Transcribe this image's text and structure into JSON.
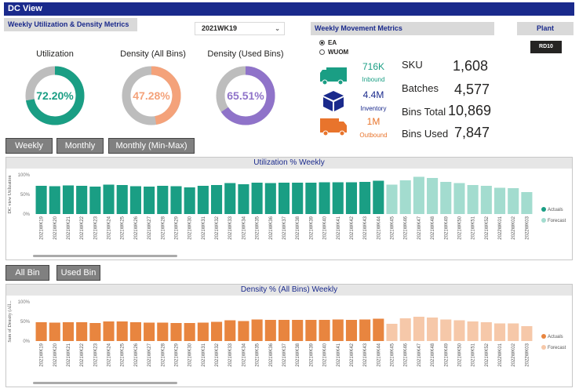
{
  "title": "DC View",
  "weekly_header": "Weekly Utilization & Density Metrics",
  "week_select": "2021WK19",
  "movement_header": "Weekly Movement Metrics",
  "plant": {
    "label": "Plant",
    "value": "RD10"
  },
  "uom": {
    "options": [
      "EA",
      "WUOM"
    ],
    "selected": "EA"
  },
  "gauges": [
    {
      "title": "Utilization",
      "value": "72.20%",
      "pct": 72.2,
      "color": "#1a9e84"
    },
    {
      "title": "Density (All Bins)",
      "value": "47.28%",
      "pct": 47.28,
      "color": "#f4a27a"
    },
    {
      "title": "Density (Used Bins)",
      "value": "65.51%",
      "pct": 65.51,
      "color": "#8f73c9"
    }
  ],
  "movement": {
    "inbound": {
      "value": "716K",
      "label": "Inbound",
      "color": "#1a9e84"
    },
    "inventory": {
      "value": "4.4M",
      "label": "Inventory",
      "color": "#1a2a8c"
    },
    "outbound": {
      "value": "1M",
      "label": "Outbound",
      "color": "#e8742c"
    }
  },
  "kpis": [
    {
      "label": "SKU",
      "value": "1,608"
    },
    {
      "label": "Batches",
      "value": "4,577"
    },
    {
      "label": "Bins Total",
      "value": "10,869"
    },
    {
      "label": "Bins Used",
      "value": "7,847"
    }
  ],
  "period_buttons": [
    "Weekly",
    "Monthly",
    "Monthly (Min-Max)"
  ],
  "bin_buttons": [
    "All Bin",
    "Used Bin"
  ],
  "colors": {
    "teal": "#1a9e84",
    "teal_light": "#a3dccf",
    "orange": "#e8853f",
    "orange_light": "#f6c8a9",
    "navy": "#1a2a8c"
  },
  "chart_data": [
    {
      "type": "bar",
      "title": "Utilization % Weekly",
      "ylabel": "DC view Utilization",
      "ylim": [
        0,
        100
      ],
      "yticks": [
        "100%",
        "50%",
        "0%"
      ],
      "categories": [
        "2021WK19",
        "2021WK20",
        "2021WK21",
        "2021WK22",
        "2021WK23",
        "2021WK24",
        "2021WK25",
        "2021WK26",
        "2021WK27",
        "2021WK28",
        "2021WK29",
        "2021WK30",
        "2021WK31",
        "2021WK32",
        "2021WK33",
        "2021WK34",
        "2021WK35",
        "2021WK36",
        "2021WK37",
        "2021WK38",
        "2021WK39",
        "2021WK40",
        "2021WK41",
        "2021WK42",
        "2021WK43",
        "2021WK44",
        "2021WK45",
        "2021WK46",
        "2021WK47",
        "2021WK48",
        "2021WK49",
        "2021WK50",
        "2021WK51",
        "2021WK52",
        "2022WK01",
        "2022WK02",
        "2022WK03"
      ],
      "series": [
        {
          "name": "Actuals",
          "values": [
            72,
            71,
            73,
            72,
            70,
            75,
            74,
            71,
            70,
            72,
            71,
            68,
            72,
            74,
            79,
            76,
            80,
            79,
            80,
            80,
            80,
            81,
            81,
            81,
            82,
            85,
            null,
            null,
            null,
            null,
            null,
            null,
            null,
            null,
            null,
            null,
            null
          ]
        },
        {
          "name": "Forecast",
          "values": [
            null,
            null,
            null,
            null,
            null,
            null,
            null,
            null,
            null,
            null,
            null,
            null,
            null,
            null,
            null,
            null,
            null,
            null,
            null,
            null,
            null,
            null,
            null,
            null,
            null,
            null,
            75,
            86,
            95,
            92,
            82,
            79,
            74,
            72,
            67,
            66,
            56
          ]
        }
      ],
      "legend": "right"
    },
    {
      "type": "bar",
      "title": "Density % (All Bins) Weekly",
      "ylabel": "Sum of Density (All...",
      "ylim": [
        0,
        100
      ],
      "yticks": [
        "100%",
        "50%",
        "0%"
      ],
      "categories": [
        "2021WK19",
        "2021WK20",
        "2021WK21",
        "2021WK22",
        "2021WK23",
        "2021WK24",
        "2021WK25",
        "2021WK26",
        "2021WK27",
        "2021WK28",
        "2021WK29",
        "2021WK30",
        "2021WK31",
        "2021WK32",
        "2021WK33",
        "2021WK34",
        "2021WK35",
        "2021WK36",
        "2021WK37",
        "2021WK38",
        "2021WK39",
        "2021WK40",
        "2021WK41",
        "2021WK42",
        "2021WK43",
        "2021WK44",
        "2021WK45",
        "2021WK46",
        "2021WK47",
        "2021WK48",
        "2021WK49",
        "2021WK50",
        "2021WK51",
        "2021WK52",
        "2022WK01",
        "2022WK02",
        "2022WK03"
      ],
      "series": [
        {
          "name": "Actuals",
          "values": [
            48,
            47,
            48,
            48,
            46,
            50,
            50,
            48,
            47,
            47,
            46,
            46,
            47,
            49,
            53,
            51,
            55,
            54,
            54,
            54,
            54,
            54,
            55,
            54,
            55,
            57,
            null,
            null,
            null,
            null,
            null,
            null,
            null,
            null,
            null,
            null,
            null
          ]
        },
        {
          "name": "Forecast",
          "values": [
            null,
            null,
            null,
            null,
            null,
            null,
            null,
            null,
            null,
            null,
            null,
            null,
            null,
            null,
            null,
            null,
            null,
            null,
            null,
            null,
            null,
            null,
            null,
            null,
            null,
            null,
            44,
            58,
            62,
            60,
            55,
            53,
            50,
            48,
            45,
            45,
            38
          ]
        }
      ],
      "legend": "right"
    }
  ]
}
